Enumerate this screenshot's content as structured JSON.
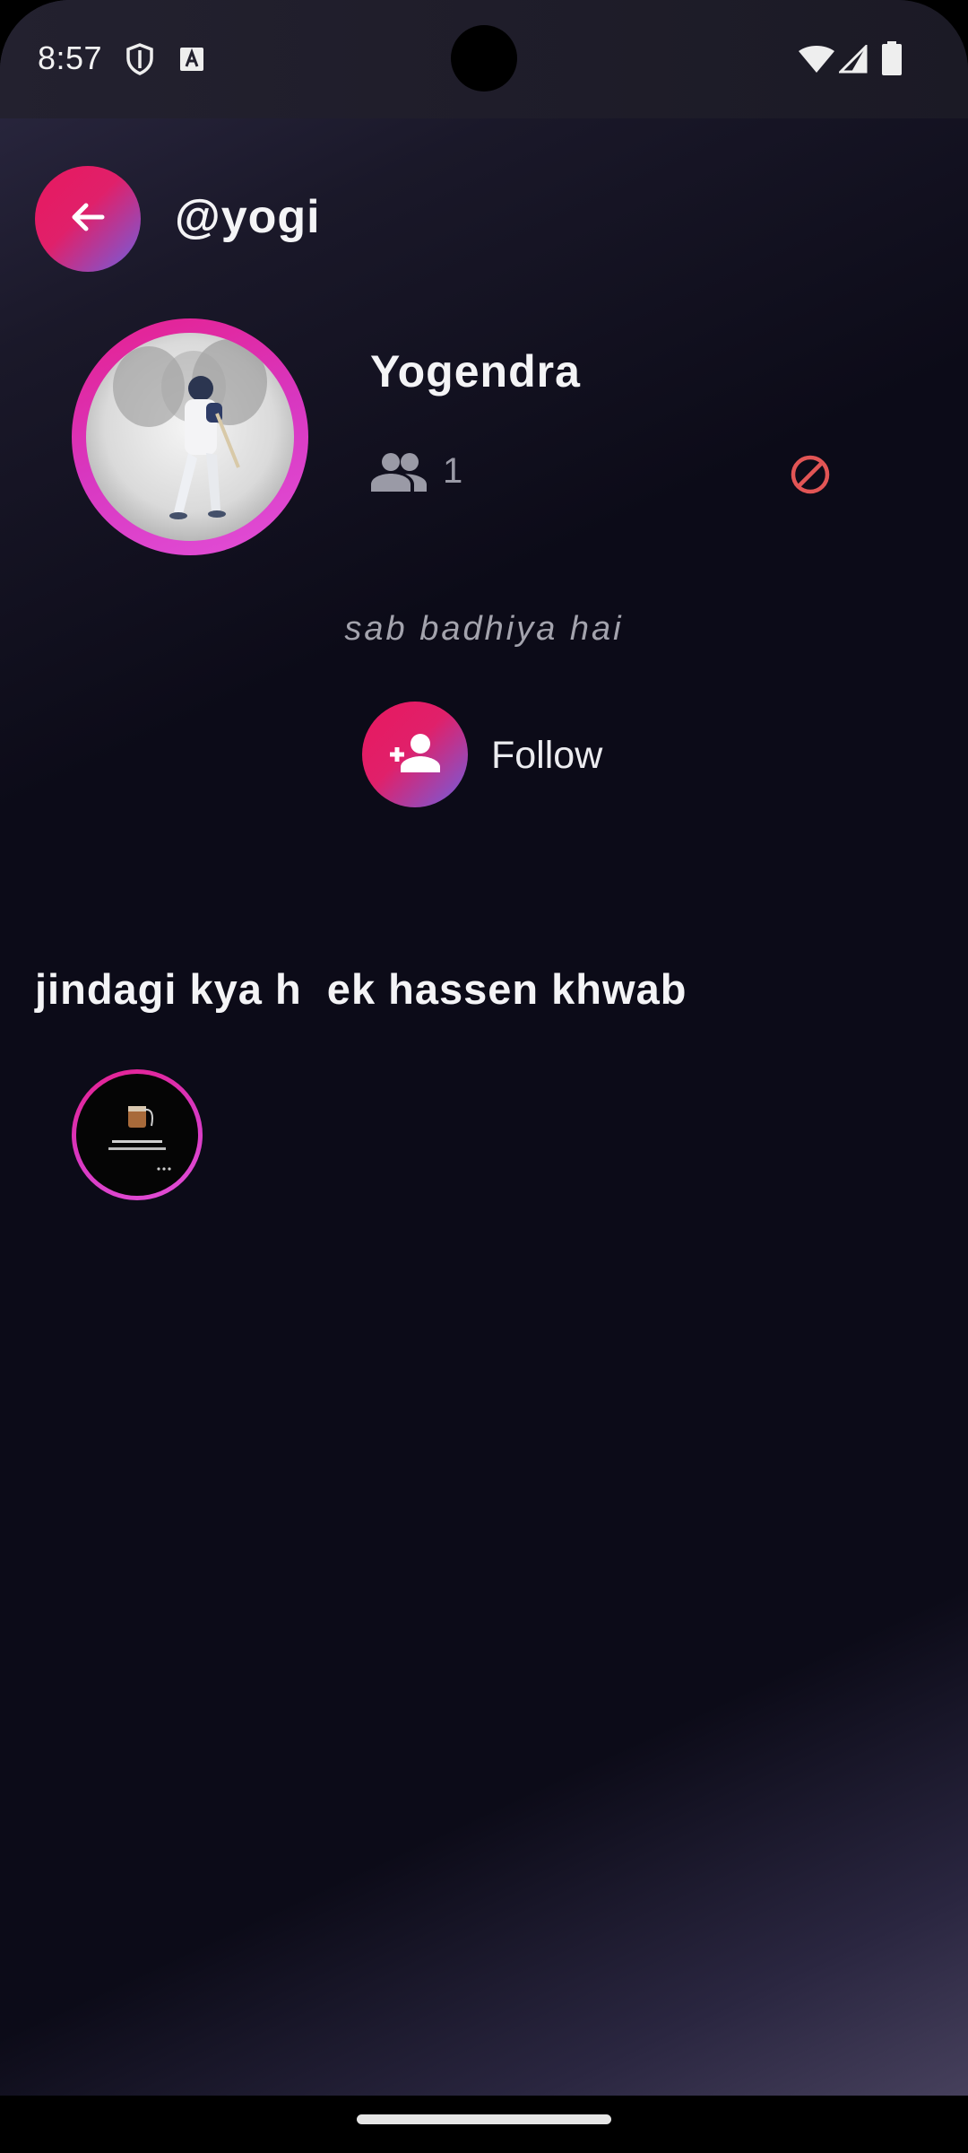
{
  "status_bar": {
    "time": "8:57",
    "icons": [
      "shield-icon",
      "keyboard-a-icon",
      "wifi-icon",
      "signal-icon",
      "battery-icon"
    ]
  },
  "header": {
    "back_icon": "arrow-left-icon",
    "handle": "@yogi"
  },
  "profile": {
    "name": "Yogendra",
    "friends_count": "1",
    "friends_icon": "people-icon",
    "block_icon": "block-icon",
    "bio": "sab badhiya hai"
  },
  "follow": {
    "label": "Follow",
    "icon": "person-add-icon"
  },
  "highlights": {
    "title": "jindagi kya h  ek hassen khwab",
    "items": [
      {
        "icon": "story-thumbnail"
      }
    ]
  },
  "colors": {
    "accent_pink": "#e8185f",
    "accent_purple": "#6f5fe0",
    "ring_magenta": "#d837c0",
    "block_red": "#e25555",
    "background": "#0c0b18"
  }
}
